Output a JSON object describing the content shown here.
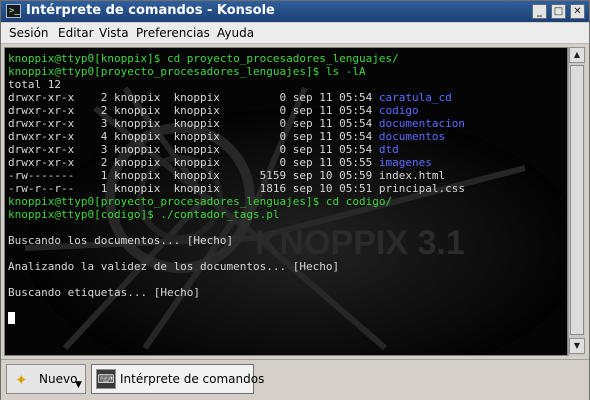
{
  "window": {
    "title": "Intérprete de comandos - Konsole",
    "sys_icon": ">_",
    "buttons": {
      "minimize": "_",
      "maximize": "□",
      "close": "✕"
    }
  },
  "menu": [
    "Sesión",
    "Editar",
    "Vista",
    "Preferencias",
    "Ayuda"
  ],
  "terminal": {
    "background_logo": "KNOPPIX 3.1",
    "lines": [
      [
        {
          "t": "knoppix@ttyp0[knoppix]$ cd proyecto_procesadores_lenguajes/",
          "c": "g"
        }
      ],
      [
        {
          "t": "knoppix@ttyp0[proyecto_procesadores_lenguajes]$ ls -lA",
          "c": "g"
        }
      ],
      [
        {
          "t": "total 12",
          "c": ""
        }
      ],
      [
        {
          "t": "drwxr-xr-x    2 knoppix  knoppix         0 sep 11 05:54 ",
          "c": ""
        },
        {
          "t": "caratula_cd",
          "c": "b"
        }
      ],
      [
        {
          "t": "drwxr-xr-x    2 knoppix  knoppix         0 sep 11 05:54 ",
          "c": ""
        },
        {
          "t": "codigo",
          "c": "b"
        }
      ],
      [
        {
          "t": "drwxr-xr-x    3 knoppix  knoppix         0 sep 11 05:54 ",
          "c": ""
        },
        {
          "t": "documentacion",
          "c": "b"
        }
      ],
      [
        {
          "t": "drwxr-xr-x    4 knoppix  knoppix         0 sep 11 05:54 ",
          "c": ""
        },
        {
          "t": "documentos",
          "c": "b"
        }
      ],
      [
        {
          "t": "drwxr-xr-x    3 knoppix  knoppix         0 sep 11 05:54 ",
          "c": ""
        },
        {
          "t": "dtd",
          "c": "b"
        }
      ],
      [
        {
          "t": "drwxr-xr-x    2 knoppix  knoppix         0 sep 11 05:55 ",
          "c": ""
        },
        {
          "t": "imagenes",
          "c": "b"
        }
      ],
      [
        {
          "t": "-rw-------    1 knoppix  knoppix      5159 sep 10 05:59 index.html",
          "c": ""
        }
      ],
      [
        {
          "t": "-rw-r--r--    1 knoppix  knoppix      1816 sep 10 05:51 principal.css",
          "c": ""
        }
      ],
      [
        {
          "t": "knoppix@ttyp0[proyecto_procesadores_lenguajes]$ cd codigo/",
          "c": "g"
        }
      ],
      [
        {
          "t": "knoppix@ttyp0[codigo]$ ./contador_tags.pl",
          "c": "g"
        }
      ],
      [],
      [
        {
          "t": "Buscando los documentos... [Hecho]",
          "c": ""
        }
      ],
      [],
      [
        {
          "t": "Analizando la validez de los documentos... [Hecho]",
          "c": ""
        }
      ],
      [],
      [
        {
          "t": "Buscando etiquetas... [Hecho]",
          "c": ""
        }
      ],
      [],
      [
        {
          "t": "",
          "c": "cursor"
        }
      ]
    ]
  },
  "scrollbar": {
    "up": "▲",
    "down": "▼"
  },
  "tabbar": {
    "new_label": "Nuevo",
    "new_icon": "✦",
    "new_arrow": "▼",
    "session_label": "Intérprete de comandos",
    "session_icon": "⌨"
  }
}
